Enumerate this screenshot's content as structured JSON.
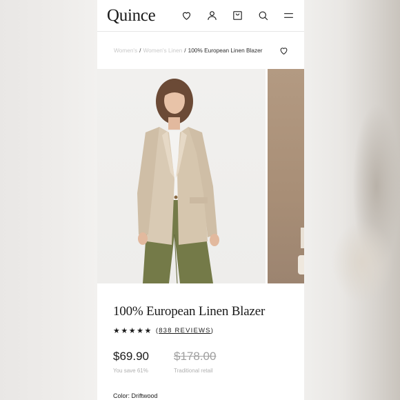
{
  "header": {
    "logo": "Quince",
    "icons": [
      "heart-icon",
      "account-icon",
      "bag-icon",
      "search-icon",
      "menu-icon"
    ]
  },
  "breadcrumb": {
    "items": [
      "Women's",
      "Women's Linen"
    ],
    "separator": "/",
    "current": "100% European Linen Blazer"
  },
  "product": {
    "title": "100% European Linen Blazer",
    "stars": "★★★★★",
    "rating_value": 5,
    "reviews_open": "(",
    "reviews_label": "838 REVIEWS",
    "reviews_close": ")",
    "price": "$69.90",
    "savings": "You save 61%",
    "retail_price": "$178.00",
    "retail_label": "Traditional retail",
    "color_label": "Color:",
    "color_value": "Driftwood"
  },
  "colors": {
    "text": "#1a1a1a",
    "muted": "#b0b0b0",
    "blazer": "#d9cab4",
    "pants": "#747a48"
  }
}
